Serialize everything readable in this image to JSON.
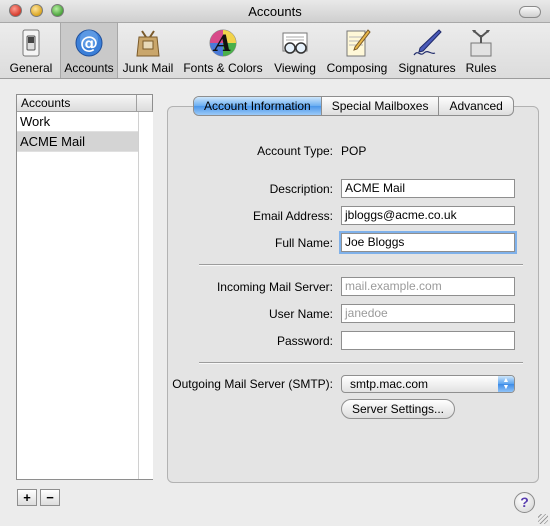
{
  "window": {
    "title": "Accounts"
  },
  "toolbar": {
    "items": [
      {
        "label": "General",
        "icon": "light-switch-icon"
      },
      {
        "label": "Accounts",
        "icon": "at-sign-icon",
        "selected": true
      },
      {
        "label": "Junk Mail",
        "icon": "junk-mail-bag-icon"
      },
      {
        "label": "Fonts & Colors",
        "icon": "fonts-colors-icon"
      },
      {
        "label": "Viewing",
        "icon": "glasses-icon"
      },
      {
        "label": "Composing",
        "icon": "notepad-pencil-icon"
      },
      {
        "label": "Signatures",
        "icon": "pen-signature-icon"
      },
      {
        "label": "Rules",
        "icon": "rules-fork-icon"
      }
    ]
  },
  "accounts_list": {
    "header": "Accounts",
    "items": [
      {
        "label": "Work"
      },
      {
        "label": "ACME Mail",
        "selected": true
      }
    ],
    "add_label": "+",
    "remove_label": "−"
  },
  "tabs": [
    {
      "label": "Account Information",
      "active": true
    },
    {
      "label": "Special Mailboxes"
    },
    {
      "label": "Advanced"
    }
  ],
  "form": {
    "account_type_label": "Account Type:",
    "account_type_value": "POP",
    "description_label": "Description:",
    "description_value": "ACME Mail",
    "email_label": "Email Address:",
    "email_value": "jbloggs@acme.co.uk",
    "fullname_label": "Full Name:",
    "fullname_value": "Joe Bloggs",
    "incoming_label": "Incoming Mail Server:",
    "incoming_placeholder": "mail.example.com",
    "username_label": "User Name:",
    "username_placeholder": "janedoe",
    "password_label": "Password:",
    "password_value": "",
    "smtp_label": "Outgoing Mail Server (SMTP):",
    "smtp_value": "smtp.mac.com",
    "server_settings_label": "Server Settings..."
  },
  "help_label": "?",
  "colors": {
    "tab_active": "#5aa3ef",
    "list_selected": "#d4d4d4"
  }
}
